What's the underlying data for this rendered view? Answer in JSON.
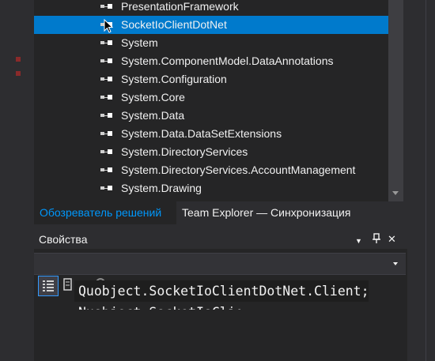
{
  "solution_explorer": {
    "references": [
      {
        "label": "PresentationFramework",
        "selected": false
      },
      {
        "label": "SocketIoClientDotNet",
        "selected": true
      },
      {
        "label": "System",
        "selected": false
      },
      {
        "label": "System.ComponentModel.DataAnnotations",
        "selected": false
      },
      {
        "label": "System.Configuration",
        "selected": false
      },
      {
        "label": "System.Core",
        "selected": false
      },
      {
        "label": "System.Data",
        "selected": false
      },
      {
        "label": "System.Data.DataSetExtensions",
        "selected": false
      },
      {
        "label": "System.DirectoryServices",
        "selected": false
      },
      {
        "label": "System.DirectoryServices.AccountManagement",
        "selected": false
      },
      {
        "label": "System.Drawing",
        "selected": false
      }
    ],
    "item_icon": "reference-icon"
  },
  "tabs": [
    {
      "label": "Обозреватель решений",
      "active": true
    },
    {
      "label": "Team Explorer — Синхронизация",
      "active": false
    }
  ],
  "properties": {
    "title": "Свойства",
    "title_icons": {
      "dropdown": "▼",
      "pin": "📌",
      "close": "✕"
    },
    "combo_value": "",
    "toolbar": [
      "categorized-icon",
      "alphabetical-icon",
      "property-pages-icon"
    ]
  },
  "tooltip": {
    "line1": "Quobject.SocketIoClientDotNet.Client;",
    "line2": "Nuobject.SocketIoClientDotNet.Client;"
  },
  "colors": {
    "selection": "#007acc",
    "active_tab_text": "#0097fb",
    "panel_bg": "#252526",
    "chrome_bg": "#2d2d30"
  }
}
